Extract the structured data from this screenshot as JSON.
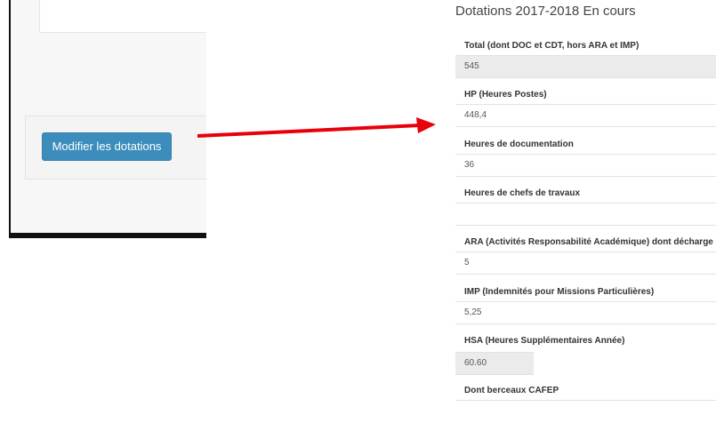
{
  "left": {
    "button_label": "Modifier les dotations"
  },
  "form": {
    "title": "Dotations 2017-2018 En cours",
    "fields": [
      {
        "label": "Total (dont DOC et CDT, hors ARA et IMP)",
        "value": "545"
      },
      {
        "label": "HP (Heures Postes)",
        "value": "448,4"
      },
      {
        "label": "Heures de documentation",
        "value": "36"
      },
      {
        "label": "Heures de chefs de travaux",
        "value": ""
      },
      {
        "label": "ARA (Activités Responsabilité Académique) dont décharge synd",
        "value": "5"
      },
      {
        "label": "IMP (Indemnités pour Missions Particulières)",
        "value": "5,25"
      },
      {
        "label": "HSA (Heures Supplémentaires Année)",
        "value": "60.60"
      },
      {
        "label": "Dont berceaux CAFEP",
        "value": ""
      }
    ]
  },
  "colors": {
    "button": "#3c8dbc",
    "arrow": "#e8000b",
    "readonly_input": "#ebebeb"
  }
}
